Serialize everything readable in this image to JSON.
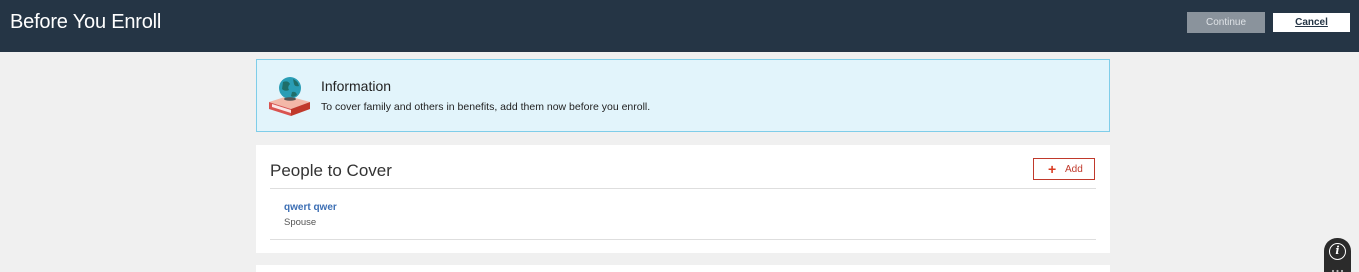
{
  "header": {
    "title": "Before You Enroll",
    "continue_label": "Continue",
    "cancel_label": "Cancel"
  },
  "info": {
    "icon": "book-globe-icon",
    "title": "Information",
    "text": "To cover family and others in benefits, add them now before you enroll."
  },
  "people": {
    "title": "People to Cover",
    "add_label": "Add",
    "add_icon": "plus-icon",
    "items": [
      {
        "name": "qwert qwer",
        "relationship": "Spouse"
      }
    ]
  },
  "help": {
    "icon": "info-icon"
  },
  "colors": {
    "header_bg": "#253545",
    "banner_bg": "#e2f4fb",
    "banner_border": "#7fcde9",
    "accent_red": "#c0392b",
    "link_blue": "#3d6fb4"
  }
}
